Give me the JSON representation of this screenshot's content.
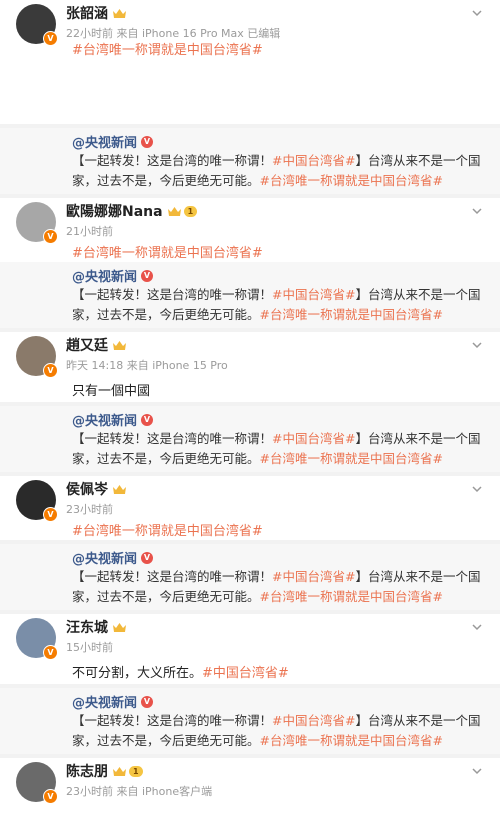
{
  "posts": [
    {
      "name": "张韶涵",
      "time": "22小时前 来自 iPhone 16 Pro Max 已编辑",
      "text": "#台湾唯一称谓就是中国台湾省#",
      "text_is_tag": true,
      "level": "",
      "avatar_color": "#3a3a3a"
    },
    {
      "name": "歐陽娜娜Nana",
      "time": "21小时前",
      "text": "#台湾唯一称谓就是中国台湾省#",
      "text_is_tag": true,
      "level": "1",
      "avatar_color": "#a7a7a7"
    },
    {
      "name": "趙又廷",
      "time": "昨天 14:18 来自 iPhone 15 Pro",
      "text": "只有一個中國",
      "text_is_tag": false,
      "level": "",
      "avatar_color": "#8a7a6a"
    },
    {
      "name": "侯佩岑",
      "time": "23小时前",
      "text": "#台湾唯一称谓就是中国台湾省#",
      "text_is_tag": true,
      "level": "",
      "avatar_color": "#2a2a2a"
    },
    {
      "name": "汪东城",
      "time": "15小时前",
      "text_plain": "不可分割，大义所在。",
      "text_tag": "#中国台湾省#",
      "level": "",
      "avatar_color": "#7a8ea8"
    },
    {
      "name": "陈志朋",
      "time": "23小时前 来自 iPhone客户端",
      "level": "1",
      "avatar_color": "#6a6a6a"
    }
  ],
  "repost": {
    "source": "@央视新闻",
    "v_mark": "V",
    "part1": "【一起转发！这是台湾的唯一称谓！",
    "tag1": "#中国台湾省#",
    "part2": "】台湾从来不是一个国家，过去不是，今后更绝无可能。",
    "tag2": "#台湾唯一称谓就是中国台湾省#"
  },
  "badge_mark": "V"
}
